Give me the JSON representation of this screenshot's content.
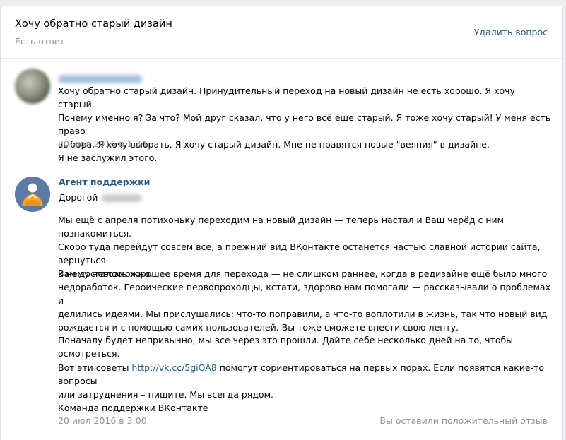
{
  "question": {
    "title": "Хочу обратно старый дизайн",
    "status": "Есть ответ.",
    "delete_label": "Удалить вопрос"
  },
  "user_message": {
    "text": "Хочу обратно старый дизайн. Принудительный переход на новый дизайн не есть хорошо. Я хочу старый.\nПочему именно я? За что? Мой друг сказал, что у него всё еще старый. Я тоже хочу старый! У меня есть право\nвыбора. Я хочу выбрать. Я хочу старый дизайн. Мне не нравятся новые \"веяния\" в дизайне.\nЯ не заслужил этого.",
    "date": "20 июл 2016 в 1:34"
  },
  "agent_message": {
    "author": "Агент поддержки",
    "greeting": "Дорогой",
    "paragraph1": "Мы ещё с апреля потихоньку переходим на новый дизайн — теперь настал и Ваш черёд с ним познакомиться.\nСкоро туда перейдут совсем все, а прежний вид ВКонтакте останется частью славной истории сайта, вернуться\nк нему невозможно.",
    "paragraph2": "Вам досталось хорошее время для перехода — не слишком раннее, когда в редизайне ещё было много\nнедоработок. Героические первопроходцы, кстати, здорово нам помогали — рассказывали о проблемах и\nделились идеями. Мы прислушались: что-то поправили, а что-то воплотили в жизнь, так что новый вид\nрождается и с помощью самих пользователей. Вы тоже сможете внести свою лепту.",
    "paragraph3": "Поначалу будет непривычно, мы все через это прошли. Дайте себе несколько дней на то, чтобы осмотреться.",
    "paragraph4_before": "Вот эти советы ",
    "paragraph4_link": "http://vk.cc/5giOA8",
    "paragraph4_after": " помогут сориентироваться на первых порах. Если появятся какие-то вопросы",
    "paragraph4_line2": "или затруднения – пишите. Мы всегда рядом.",
    "signature": "Команда поддержки ВКонтакте",
    "date": "20 июл 2016 в 3:00",
    "feedback": "Вы оставили положительный отзыв"
  },
  "colors": {
    "link": "#2a5885",
    "muted": "#939393",
    "agent_avatar_bg": "#5c7aa5",
    "agent_avatar_figure": "#f5a623"
  },
  "icons": {
    "agent_avatar": "support-agent-meditating-icon"
  }
}
